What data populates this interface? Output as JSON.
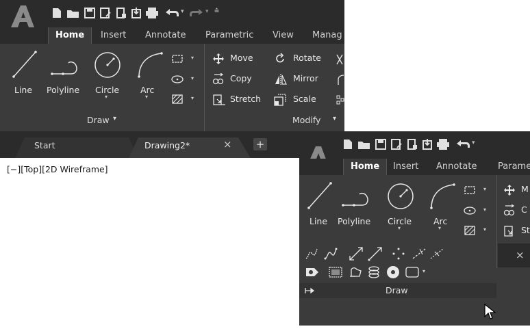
{
  "window_main": {
    "tabs": [
      "Home",
      "Insert",
      "Annotate",
      "Parametric",
      "View",
      "Manag"
    ],
    "draw_tools": [
      "Line",
      "Polyline",
      "Circle",
      "Arc"
    ],
    "modify_tools": [
      {
        "label": "Move",
        "icon": "move-icon"
      },
      {
        "label": "Rotate",
        "icon": "rotate-icon"
      },
      {
        "label": "Copy",
        "icon": "copy-icon"
      },
      {
        "label": "Mirror",
        "icon": "mirror-icon"
      },
      {
        "label": "Stretch",
        "icon": "stretch-icon"
      },
      {
        "label": "Scale",
        "icon": "scale-icon"
      }
    ],
    "panel_draw": "Draw",
    "panel_modify": "Modify",
    "doc_tabs": [
      "Start",
      "Drawing2*"
    ],
    "close_glyph": "×",
    "add_glyph": "+",
    "viewport_label": "[−][Top][2D Wireframe]"
  },
  "window_zoom": {
    "tabs": [
      "Home",
      "Insert",
      "Annotate",
      "Parame"
    ],
    "draw_tools": [
      "Line",
      "Polyline",
      "Circle",
      "Arc"
    ],
    "modify_partial": [
      "M",
      "C",
      "St"
    ],
    "panel_draw": "Draw",
    "close_glyph": "×"
  }
}
